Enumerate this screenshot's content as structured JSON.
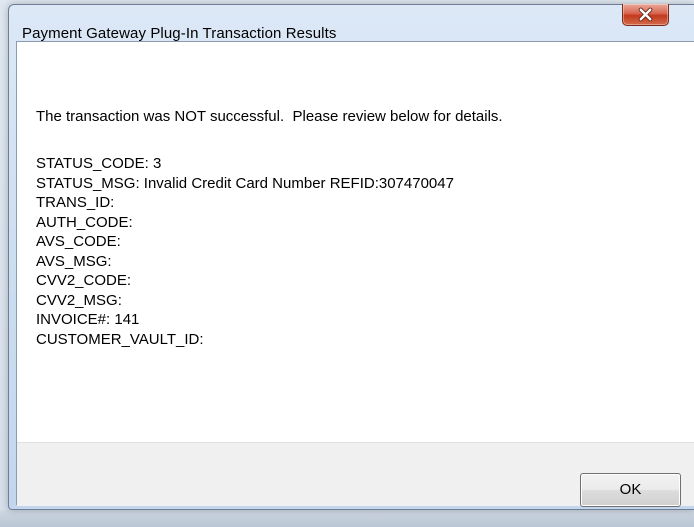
{
  "window": {
    "title": "Payment Gateway Plug-In Transaction Results",
    "close_icon": "close-icon"
  },
  "message": "The transaction was NOT successful.  Please review below for details.",
  "details": [
    "STATUS_CODE: 3",
    "STATUS_MSG: Invalid Credit Card Number REFID:307470047",
    "TRANS_ID:",
    "AUTH_CODE:",
    "AVS_CODE:",
    "AVS_MSG:",
    "CVV2_CODE:",
    "CVV2_MSG:",
    "INVOICE#: 141",
    "CUSTOMER_VAULT_ID:"
  ],
  "buttons": {
    "ok_label": "OK"
  }
}
